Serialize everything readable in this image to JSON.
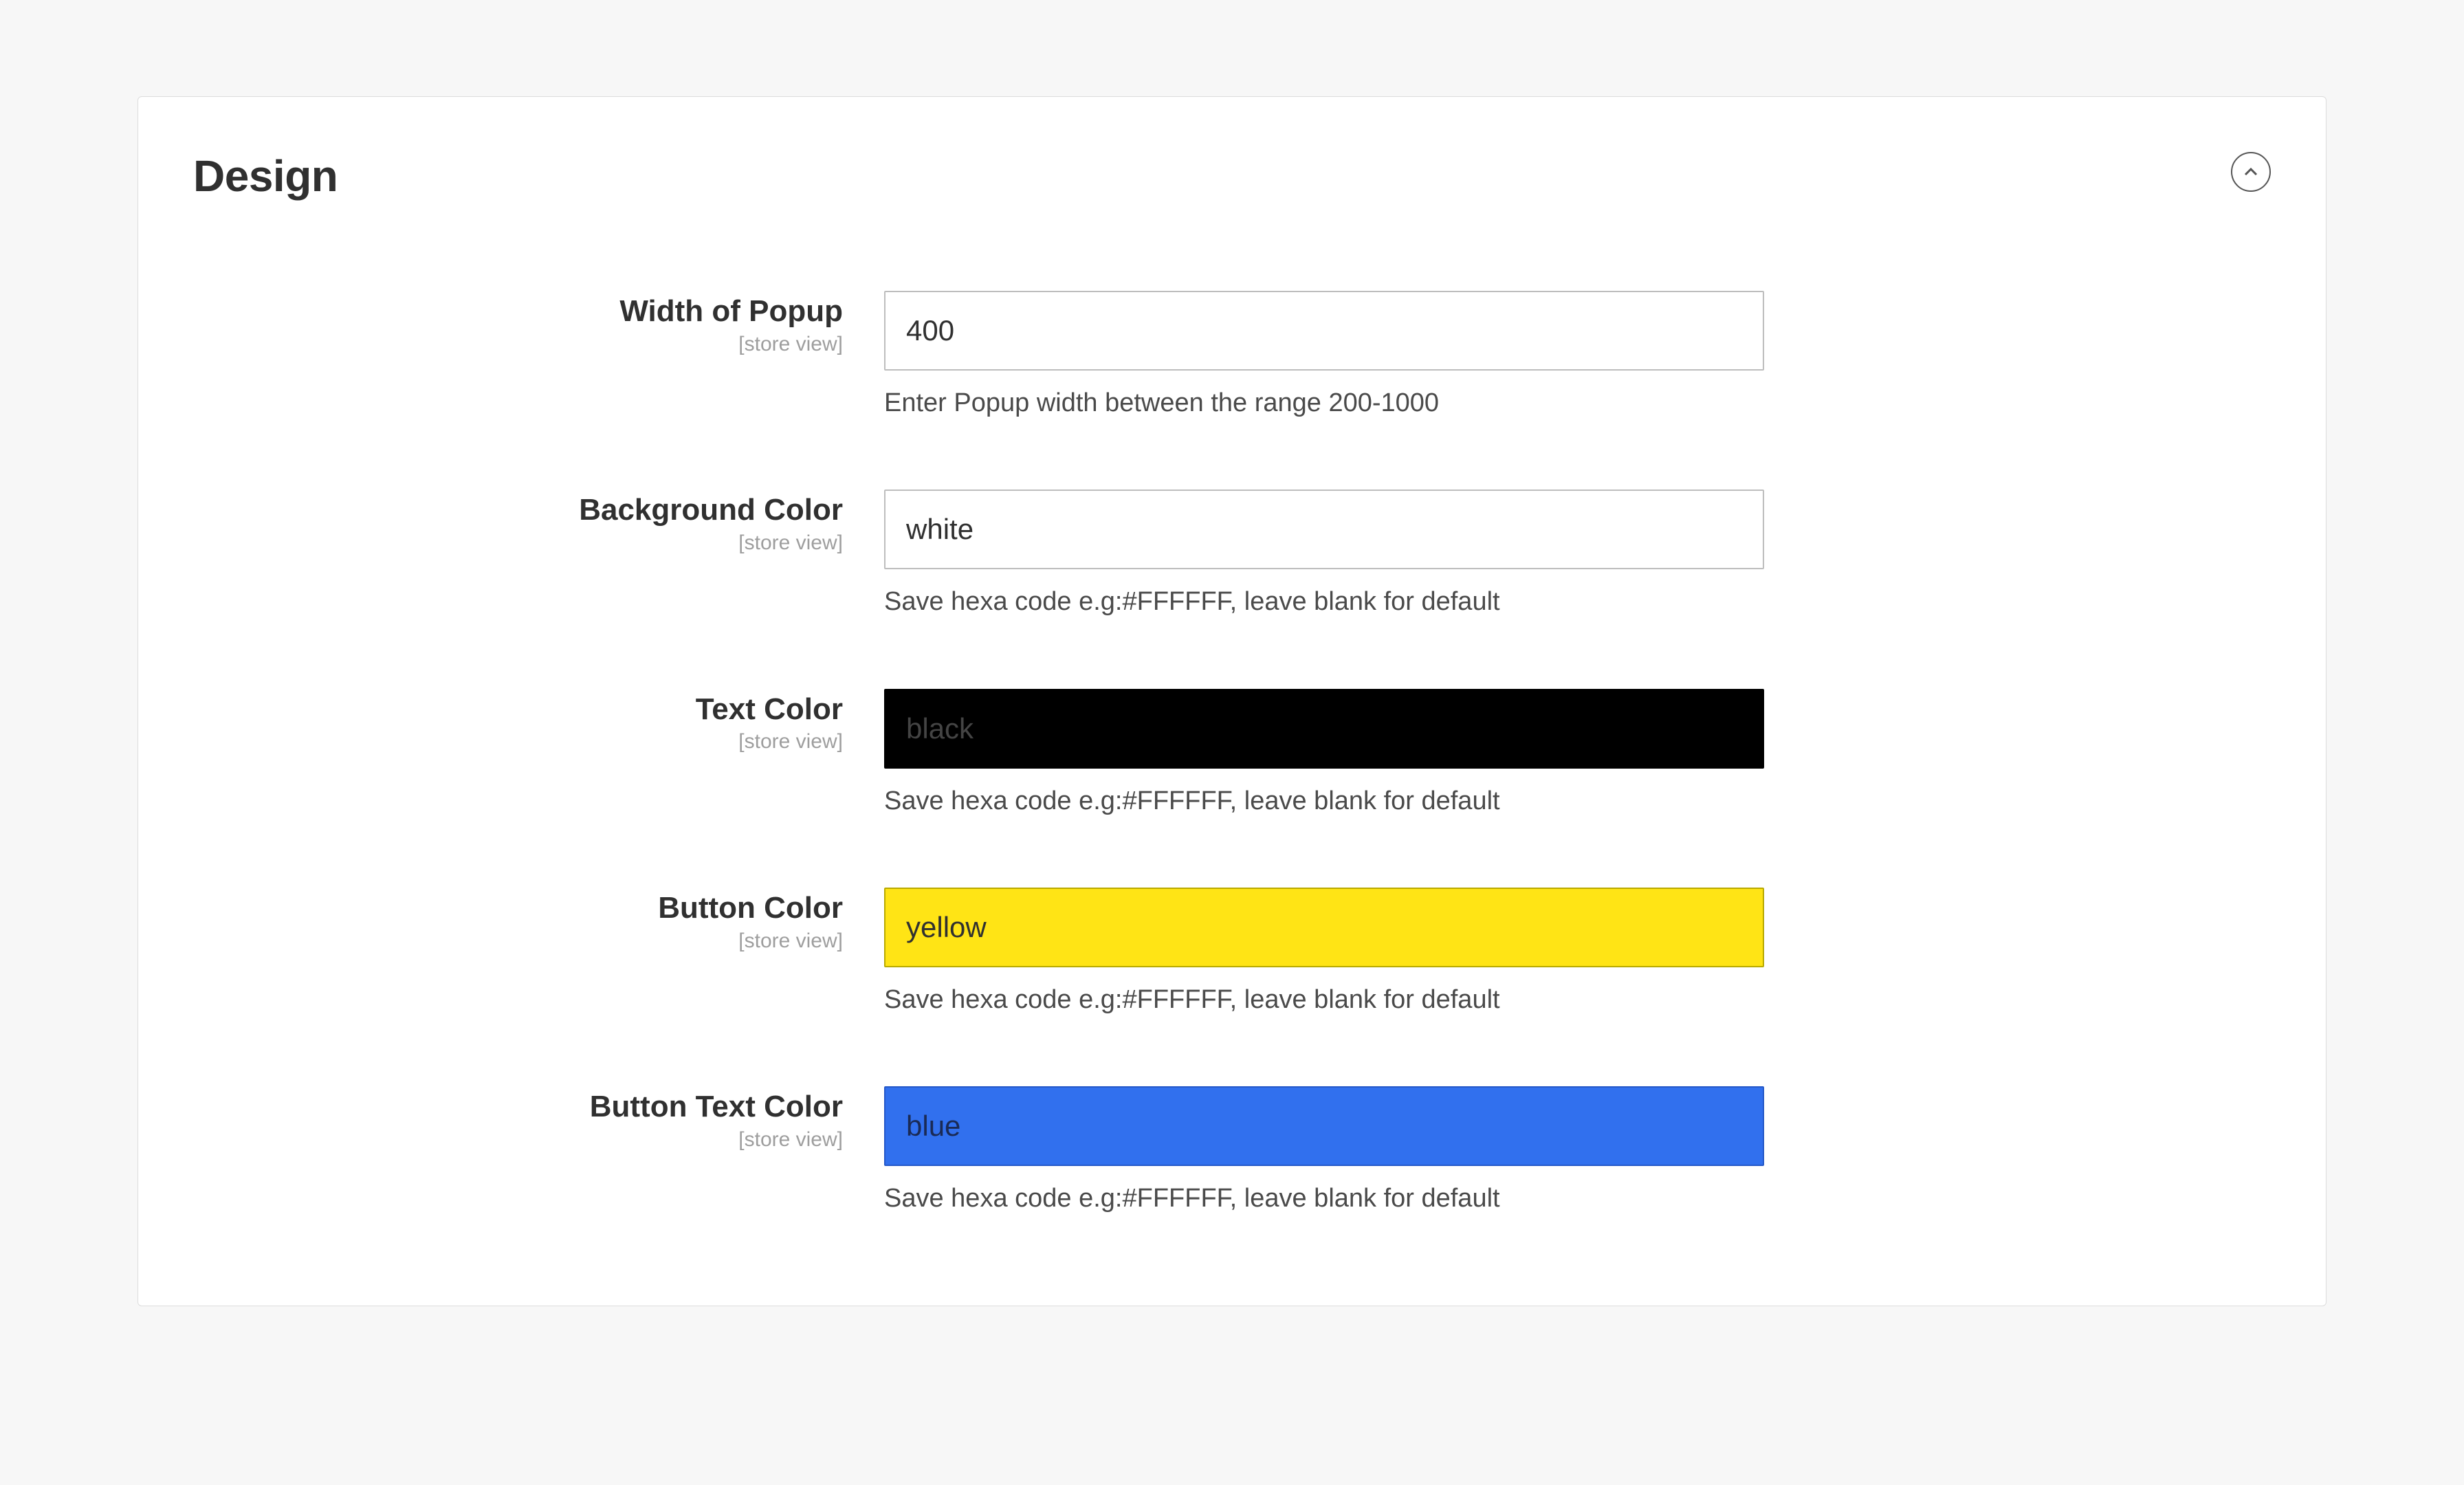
{
  "panel": {
    "title": "Design",
    "scope_label": "[store view]"
  },
  "fields": {
    "width": {
      "label": "Width of Popup",
      "value": "400",
      "helper": "Enter Popup width between the range 200-1000",
      "bg": "#ffffff",
      "fg": "#303030",
      "border": "#bdbdbd"
    },
    "bg_color": {
      "label": "Background Color",
      "value": "white",
      "helper": "Save hexa code e.g:#FFFFFF, leave blank for default",
      "bg": "#ffffff",
      "fg": "#303030",
      "border": "#bdbdbd"
    },
    "text_color": {
      "label": "Text Color",
      "value": "black",
      "helper": "Save hexa code e.g:#FFFFFF, leave blank for default",
      "bg": "#000000",
      "fg": "#444444",
      "border": "#000000"
    },
    "button_color": {
      "label": "Button Color",
      "value": "yellow",
      "helper": "Save hexa code e.g:#FFFFFF, leave blank for default",
      "bg": "#ffe415",
      "fg": "#303030",
      "border": "#b8a900"
    },
    "button_text_color": {
      "label": "Button Text Color",
      "value": "blue",
      "helper": "Save hexa code e.g:#FFFFFF, leave blank for default",
      "bg": "#3170ee",
      "fg": "#1a2a55",
      "border": "#2458c8"
    }
  }
}
